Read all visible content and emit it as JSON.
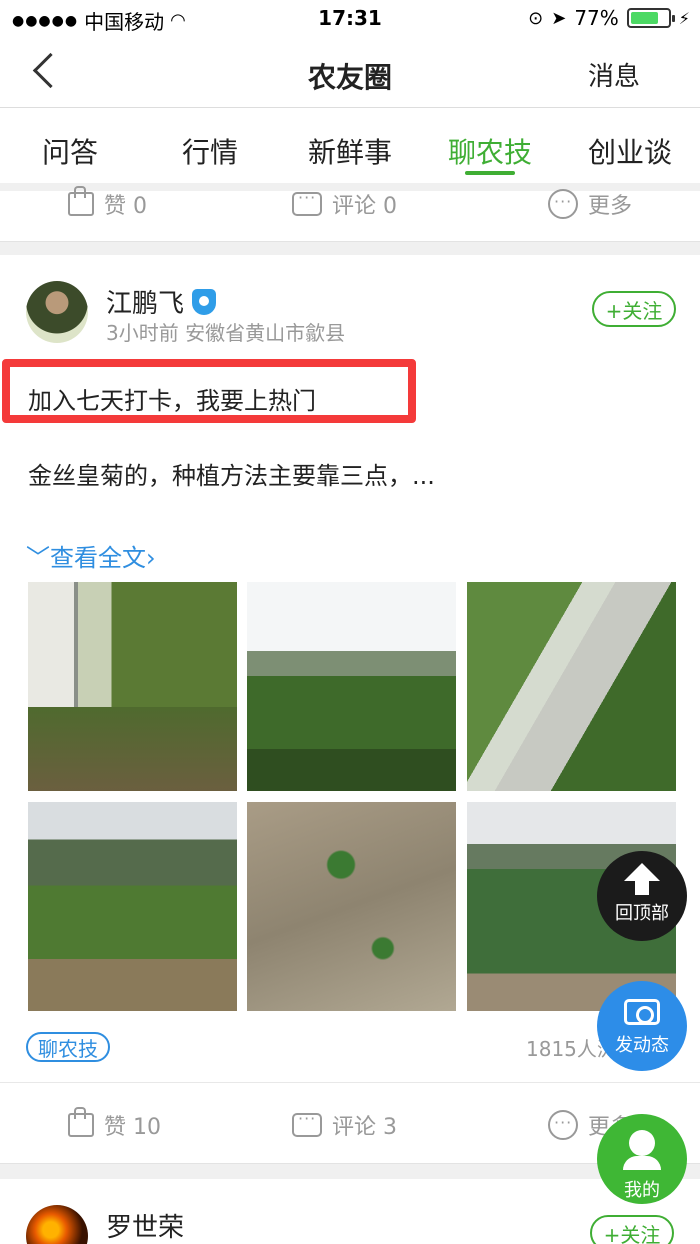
{
  "status_bar": {
    "carrier": "中国移动",
    "time": "17:31",
    "battery": "77%",
    "battery_level": 0.77
  },
  "nav": {
    "title": "农友圈",
    "messages": "消息"
  },
  "tabs": [
    {
      "label": "问答",
      "active": false
    },
    {
      "label": "行情",
      "active": false
    },
    {
      "label": "新鲜事",
      "active": false
    },
    {
      "label": "聊农技",
      "active": true
    },
    {
      "label": "创业谈",
      "active": false
    }
  ],
  "prev_post_actions": {
    "like": "赞 0",
    "comment": "评论 0",
    "more": "更多"
  },
  "post": {
    "author": "江鹏飞",
    "meta": "3小时前 安徽省黄山市歙县",
    "follow": "+关注",
    "headline": "加入七天打卡，我要上热门",
    "summary": "金丝皇菊的，种植方法主要靠三点，...",
    "read_more": "查看全文",
    "tag": "聊农技",
    "views": "1815人浏览",
    "actions": {
      "like": "赞 10",
      "comment": "评论 3",
      "more": "更多"
    }
  },
  "next_post": {
    "author": "罗世荣",
    "follow": "+关注"
  },
  "fabs": {
    "back_to_top": "回顶部",
    "post": "发动态",
    "me": "我的"
  }
}
